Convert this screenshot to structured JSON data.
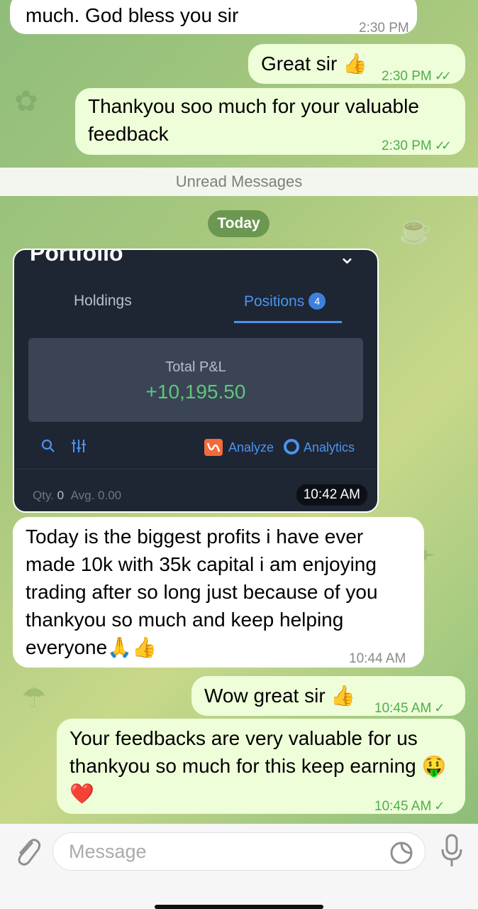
{
  "messages": [
    {
      "text": "much. God bless you sir",
      "time": "2:30 PM"
    },
    {
      "text": "Great sir 👍",
      "time": "2:30 PM"
    },
    {
      "text": "Thankyou soo much for your valuable feedback",
      "time": "2:30 PM"
    },
    {
      "text": "Today is the biggest profits i have ever made 10k with 35k capital i am enjoying trading after so long just because of you thankyou so much and keep helping everyone🙏👍",
      "time": "10:44 AM"
    },
    {
      "text": "Wow great sir 👍",
      "time": "10:45 AM"
    },
    {
      "text": "Your feedbacks are very valuable for us thankyou so much for this keep earning 🤑❤️",
      "time": "10:45 AM"
    }
  ],
  "unread_label": "Unread Messages",
  "date_pill": "Today",
  "photo": {
    "title": "Portfolio",
    "tab_holdings": "Holdings",
    "tab_positions": "Positions",
    "positions_count": "4",
    "pnl_label": "Total P&L",
    "pnl_value": "+10,195.50",
    "analyze": "Analyze",
    "analytics": "Analytics",
    "qty_label": "Qty.",
    "qty_value": "0",
    "avg_label": "Avg.",
    "avg_value": "0.00",
    "time": "10:42 AM"
  },
  "input": {
    "placeholder": "Message"
  },
  "icons": [
    "attach-icon",
    "sticker-icon",
    "mic-icon",
    "search-icon",
    "filter-icon",
    "analyze-icon",
    "analytics-icon",
    "chevron-down-icon"
  ],
  "colors": {
    "outgoing": "#eefed9",
    "incoming": "#ffffff",
    "tick": "#4fae4e",
    "pnl": "#5fc67a",
    "accent": "#4c93f0"
  }
}
